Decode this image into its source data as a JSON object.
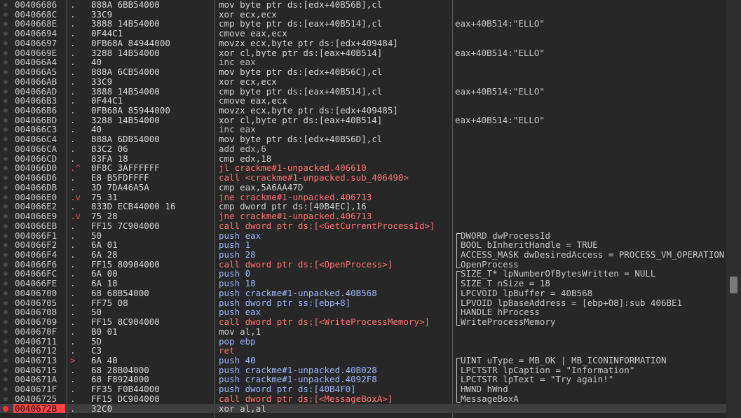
{
  "theme": {
    "background": "#272727",
    "selected_row_bg": "#3e3e3e",
    "selected_address_bg": "#ff4444",
    "breakpoint_color": "#ff3232",
    "jump_color": "#ff7272"
  },
  "rows": [
    {
      "addr": "00406686",
      "mark": ".",
      "bytes": "888A 6BB54000",
      "instr": "mov byte ptr ds:[edx+40B56B],cl",
      "kind": "mov",
      "comment": ""
    },
    {
      "addr": "0040668C",
      "mark": ".",
      "bytes": "33C9",
      "instr": "xor ecx,ecx",
      "kind": "xor",
      "comment": ""
    },
    {
      "addr": "0040668E",
      "mark": ".",
      "bytes": "3888 14B54000",
      "instr": "cmp byte ptr ds:[eax+40B514],cl",
      "kind": "cmp",
      "comment": "eax+40B514:\"ELLO\""
    },
    {
      "addr": "00406694",
      "mark": ".",
      "bytes": "0F44C1",
      "instr": "cmove eax,ecx",
      "kind": "mov",
      "comment": ""
    },
    {
      "addr": "00406697",
      "mark": ".",
      "bytes": "0FB68A 84944000",
      "instr": "movzx ecx,byte ptr ds:[edx+409484]",
      "kind": "mov",
      "comment": ""
    },
    {
      "addr": "0040669E",
      "mark": ".",
      "bytes": "3288 14B54000",
      "instr": "xor cl,byte ptr ds:[eax+40B514]",
      "kind": "xor",
      "comment": "eax+40B514:\"ELLO\""
    },
    {
      "addr": "004066A4",
      "mark": ".",
      "bytes": "40",
      "instr": "inc eax",
      "kind": "def",
      "comment": ""
    },
    {
      "addr": "004066A5",
      "mark": ".",
      "bytes": "888A 6CB54000",
      "instr": "mov byte ptr ds:[edx+40B56C],cl",
      "kind": "mov",
      "comment": ""
    },
    {
      "addr": "004066AB",
      "mark": ".",
      "bytes": "33C9",
      "instr": "xor ecx,ecx",
      "kind": "xor",
      "comment": ""
    },
    {
      "addr": "004066AD",
      "mark": ".",
      "bytes": "3888 14B54000",
      "instr": "cmp byte ptr ds:[eax+40B514],cl",
      "kind": "cmp",
      "comment": "eax+40B514:\"ELLO\""
    },
    {
      "addr": "004066B3",
      "mark": ".",
      "bytes": "0F44C1",
      "instr": "cmove eax,ecx",
      "kind": "mov",
      "comment": ""
    },
    {
      "addr": "004066B6",
      "mark": ".",
      "bytes": "0FB68A 85944000",
      "instr": "movzx ecx,byte ptr ds:[edx+409485]",
      "kind": "mov",
      "comment": ""
    },
    {
      "addr": "004066BD",
      "mark": ".",
      "bytes": "3288 14B54000",
      "instr": "xor cl,byte ptr ds:[eax+40B514]",
      "kind": "xor",
      "comment": "eax+40B514:\"ELLO\""
    },
    {
      "addr": "004066C3",
      "mark": ".",
      "bytes": "40",
      "instr": "inc eax",
      "kind": "def",
      "comment": ""
    },
    {
      "addr": "004066C4",
      "mark": ".",
      "bytes": "888A 6DB54000",
      "instr": "mov byte ptr ds:[edx+40B56D],cl",
      "kind": "mov",
      "comment": ""
    },
    {
      "addr": "004066CA",
      "mark": ".",
      "bytes": "83C2 06",
      "instr": "add edx,6",
      "kind": "def",
      "comment": ""
    },
    {
      "addr": "004066CD",
      "mark": ".",
      "bytes": "83FA 18",
      "instr": "cmp edx,18",
      "kind": "cmp",
      "comment": ""
    },
    {
      "addr": "004066D0",
      "mark": ".^",
      "bytes": "0F8C 3AFFFFFF",
      "instr": "jl crackme#1-unpacked.406610",
      "kind": "jmp",
      "comment": ""
    },
    {
      "addr": "004066D6",
      "mark": ".",
      "bytes": "E8 B5FDFFFF",
      "instr": "call <crackme#1-unpacked.sub_406490>",
      "kind": "call",
      "comment": ""
    },
    {
      "addr": "004066DB",
      "mark": ".",
      "bytes": "3D 7DA46A5A",
      "instr": "cmp eax,5A6AA47D",
      "kind": "cmp",
      "comment": ""
    },
    {
      "addr": "004066E0",
      "mark": ".v",
      "bytes": "75 31",
      "instr": "jne crackme#1-unpacked.406713",
      "kind": "jmp",
      "comment": ""
    },
    {
      "addr": "004066E2",
      "mark": ".",
      "bytes": "833D ECB44000 16",
      "instr": "cmp dword ptr ds:[40B4EC],16",
      "kind": "cmp",
      "comment": ""
    },
    {
      "addr": "004066E9",
      "mark": ".v",
      "bytes": "75 28",
      "instr": "jne crackme#1-unpacked.406713",
      "kind": "jmp",
      "comment": ""
    },
    {
      "addr": "004066EB",
      "mark": ".",
      "bytes": "FF15 7C904000",
      "instr": "call dword ptr ds:[<GetCurrentProcessId>]",
      "kind": "callapi",
      "comment": ""
    },
    {
      "addr": "004066F1",
      "mark": ".",
      "bytes": "50",
      "instr": "push eax",
      "kind": "push",
      "comment": "DWORD dwProcessId"
    },
    {
      "addr": "004066F2",
      "mark": ".",
      "bytes": "6A 01",
      "instr": "push 1",
      "kind": "push",
      "comment": "BOOL bInheritHandle = TRUE"
    },
    {
      "addr": "004066F4",
      "mark": ".",
      "bytes": "6A 28",
      "instr": "push 28",
      "kind": "push",
      "comment": "ACCESS_MASK dwDesiredAccess = PROCESS_VM_OPERATION"
    },
    {
      "addr": "004066F6",
      "mark": ".",
      "bytes": "FF15 80904000",
      "instr": "call dword ptr ds:[<OpenProcess>]",
      "kind": "callapi",
      "comment": "OpenProcess"
    },
    {
      "addr": "004066FC",
      "mark": ".",
      "bytes": "6A 00",
      "instr": "push 0",
      "kind": "push",
      "comment": "SIZE_T* lpNumberOfBytesWritten = NULL"
    },
    {
      "addr": "004066FE",
      "mark": ".",
      "bytes": "6A 18",
      "instr": "push 18",
      "kind": "push",
      "comment": "SIZE_T nSize = 18"
    },
    {
      "addr": "00406700",
      "mark": ".",
      "bytes": "68 68B54000",
      "instr": "push crackme#1-unpacked.40B568",
      "kind": "push",
      "comment": "LPCVOID lpBuffer = 40B568"
    },
    {
      "addr": "00406705",
      "mark": ".",
      "bytes": "FF75 08",
      "instr": "push dword ptr ss:[ebp+8]",
      "kind": "push",
      "comment": "LPVOID lpBaseAddress = [ebp+08]:sub_406BE1"
    },
    {
      "addr": "00406708",
      "mark": ".",
      "bytes": "50",
      "instr": "push eax",
      "kind": "push",
      "comment": "HANDLE hProcess"
    },
    {
      "addr": "00406709",
      "mark": ".",
      "bytes": "FF15 8C904000",
      "instr": "call dword ptr ds:[<WriteProcessMemory>]",
      "kind": "callapi",
      "comment": "WriteProcessMemory"
    },
    {
      "addr": "0040670F",
      "mark": ".",
      "bytes": "B0 01",
      "instr": "mov al,1",
      "kind": "mov",
      "comment": ""
    },
    {
      "addr": "00406711",
      "mark": ".",
      "bytes": "5D",
      "instr": "pop ebp",
      "kind": "push",
      "comment": ""
    },
    {
      "addr": "00406712",
      "mark": ".",
      "bytes": "C3",
      "instr": "ret",
      "kind": "ret",
      "comment": ""
    },
    {
      "addr": "00406713",
      "mark": ">",
      "bytes": "6A 40",
      "instr": "push 40",
      "kind": "push",
      "comment": "UINT uType = MB_OK | MB_ICONINFORMATION"
    },
    {
      "addr": "00406715",
      "mark": ".",
      "bytes": "68 28B04000",
      "instr": "push crackme#1-unpacked.40B028",
      "kind": "push",
      "comment": "LPCTSTR lpCaption = \"Information\""
    },
    {
      "addr": "0040671A",
      "mark": ".",
      "bytes": "68 F8924000",
      "instr": "push crackme#1-unpacked.4092F8",
      "kind": "push",
      "comment": "LPCTSTR lpText = \"Try again!\""
    },
    {
      "addr": "0040671F",
      "mark": ".",
      "bytes": "FF35 F0B44000",
      "instr": "push dword ptr ds:[40B4F0]",
      "kind": "push",
      "comment": "HWND hWnd"
    },
    {
      "addr": "00406725",
      "mark": ".",
      "bytes": "FF15 DC904000",
      "instr": "call dword ptr ds:[<MessageBoxA>]",
      "kind": "callapi",
      "comment": "MessageBoxA"
    },
    {
      "addr": "0040672B",
      "mark": ".",
      "bytes": "32C0",
      "instr": "xor al,al",
      "kind": "xor",
      "comment": "",
      "selected": true,
      "breakpoint": true
    }
  ],
  "brackets": [
    {
      "start": 24,
      "end": 27
    },
    {
      "start": 28,
      "end": 33
    },
    {
      "start": 37,
      "end": 41
    }
  ],
  "scrollbar": {
    "position_fraction": 0.69
  }
}
